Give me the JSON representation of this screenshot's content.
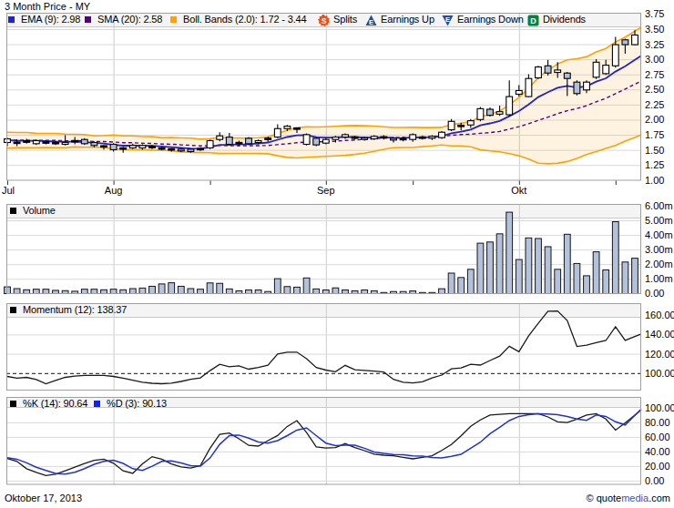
{
  "title": "3 Month Price - MY",
  "price_legend": {
    "ema_label": "EMA (9): 2.98",
    "sma_label": "SMA (20): 2.58",
    "boll_label": "Boll. Bands (2.0): 1.72 - 3.44",
    "splits_label": "Splits",
    "earnings_up_label": "Earnings Up",
    "earnings_down_label": "Earnings Down",
    "dividends_label": "Dividends",
    "splits_icon_letter": "S",
    "earnings_icon_letter": "E",
    "dividends_icon_letter": "D"
  },
  "volume_legend": {
    "label": "Volume"
  },
  "momentum_legend": {
    "label": "Momentum (12): 138.37"
  },
  "stoch_legend": {
    "k_label": "%K (14): 90.64",
    "d_label": "%D (3): 90.13"
  },
  "footer": {
    "date": "Oktober 17, 2013",
    "copyright": "© ",
    "brand_quote": "quote",
    "brand_media": "media",
    "brand_com": ".com"
  },
  "colors": {
    "ema": "#2222cc",
    "sma": "#55007f",
    "boll": "#ffa200",
    "boll_fill": "rgba(247,166,37,0.14)",
    "candle_up": "#ffffff",
    "candle_down": "#b0bfd8",
    "candle_line": "#000000",
    "volume_fill": "#b3c2d9",
    "volume_line": "#14141e",
    "momentum": "#1a1a1a",
    "stoch_k": "#1a1a1a",
    "stoch_d": "#2233cc",
    "splits_icon": "#e8521a",
    "earnings_icon": "#1b4fa0",
    "dividends_icon": "#00843d",
    "grid": "#d9d9d9",
    "month_grid": "#cccccc",
    "panel_border": "#a0a0a0",
    "strip_bg": "#f4f4f4"
  },
  "axes": {
    "price_labels": [
      "3.75",
      "3.50",
      "3.25",
      "3.00",
      "2.75",
      "2.50",
      "2.25",
      "2.00",
      "1.75",
      "1.50",
      "1.25",
      "1.00"
    ],
    "volume_labels": [
      "6.00m",
      "5.00m",
      "4.00m",
      "3.00m",
      "2.00m",
      "1.00m",
      "0.00"
    ],
    "momentum_labels": [
      "160.00",
      "140.00",
      "120.00",
      "100.00"
    ],
    "stoch_labels": [
      "100.00",
      "80.00",
      "60.00",
      "40.00",
      "20.00",
      "0.00"
    ],
    "x_labels": [
      "Jul",
      "Aug",
      "Sep",
      "Okt"
    ]
  },
  "chart_data": {
    "type": "candlestick",
    "symbol": "MY",
    "period": "3 Month Price",
    "as_of_date": "Oktober 17, 2013",
    "n_days": 66,
    "month_tick_indices": {
      "Jul": 0,
      "Aug": 11,
      "Sep": 33,
      "Okt": 53
    },
    "minor_tick_indices": [
      21,
      42,
      63
    ],
    "price_axis": {
      "min": 1.0,
      "max": 3.75,
      "step": 0.25
    },
    "volume_axis": {
      "min": 0,
      "max": 6,
      "step": 1,
      "unit": "millions"
    },
    "momentum_axis": {
      "gridlines": [
        160,
        140,
        120
      ],
      "baseline": 100
    },
    "stoch_axis": {
      "min": 0,
      "max": 100,
      "step": 20
    },
    "open": [
      1.63,
      1.63,
      1.64,
      1.61,
      1.63,
      1.62,
      1.6,
      1.66,
      1.68,
      1.63,
      1.57,
      1.6,
      1.54,
      1.54,
      1.54,
      1.55,
      1.53,
      1.52,
      1.52,
      1.52,
      1.52,
      1.54,
      1.68,
      1.72,
      1.62,
      1.7,
      1.63,
      1.68,
      1.72,
      1.86,
      1.86,
      1.6,
      1.7,
      1.62,
      1.68,
      1.72,
      1.71,
      1.71,
      1.69,
      1.71,
      1.7,
      1.68,
      1.68,
      1.71,
      1.7,
      1.71,
      1.84,
      1.9,
      1.92,
      2.01,
      2.18,
      2.1,
      2.09,
      2.43,
      2.39,
      2.7,
      2.9,
      2.79,
      2.78,
      2.63,
      2.5,
      2.71,
      2.77,
      2.9,
      3.33,
      3.25
    ],
    "high": [
      1.71,
      1.68,
      1.69,
      1.68,
      1.66,
      1.65,
      1.75,
      1.72,
      1.7,
      1.65,
      1.59,
      1.62,
      1.56,
      1.61,
      1.6,
      1.59,
      1.56,
      1.54,
      1.54,
      1.53,
      1.55,
      1.68,
      1.8,
      1.79,
      1.66,
      1.72,
      1.68,
      1.73,
      1.93,
      1.92,
      1.88,
      1.78,
      1.72,
      1.71,
      1.74,
      1.78,
      1.74,
      1.73,
      1.75,
      1.75,
      1.72,
      1.73,
      1.78,
      1.74,
      1.75,
      1.82,
      2.02,
      1.96,
      2.02,
      2.22,
      2.21,
      2.24,
      2.66,
      2.58,
      2.76,
      2.9,
      3.0,
      2.96,
      2.8,
      2.66,
      2.66,
      3.01,
      3.0,
      3.38,
      3.35,
      3.49
    ],
    "low": [
      1.57,
      1.57,
      1.61,
      1.59,
      1.6,
      1.59,
      1.58,
      1.6,
      1.59,
      1.55,
      1.51,
      1.48,
      1.46,
      1.52,
      1.51,
      1.52,
      1.5,
      1.48,
      1.47,
      1.46,
      1.49,
      1.52,
      1.65,
      1.58,
      1.57,
      1.59,
      1.6,
      1.64,
      1.7,
      1.82,
      1.79,
      1.58,
      1.57,
      1.6,
      1.63,
      1.69,
      1.68,
      1.66,
      1.67,
      1.68,
      1.63,
      1.65,
      1.64,
      1.68,
      1.67,
      1.69,
      1.82,
      1.83,
      1.87,
      1.98,
      2.06,
      2.07,
      2.06,
      2.39,
      2.38,
      2.68,
      2.74,
      2.7,
      2.4,
      2.41,
      2.45,
      2.68,
      2.75,
      2.87,
      3.1,
      3.24
    ],
    "close": [
      1.69,
      1.62,
      1.65,
      1.66,
      1.63,
      1.62,
      1.63,
      1.64,
      1.61,
      1.58,
      1.56,
      1.51,
      1.52,
      1.58,
      1.58,
      1.56,
      1.53,
      1.51,
      1.49,
      1.48,
      1.52,
      1.66,
      1.74,
      1.6,
      1.62,
      1.61,
      1.66,
      1.7,
      1.86,
      1.9,
      1.86,
      1.76,
      1.59,
      1.68,
      1.72,
      1.76,
      1.71,
      1.68,
      1.73,
      1.72,
      1.67,
      1.69,
      1.76,
      1.71,
      1.73,
      1.8,
      1.98,
      1.91,
      1.99,
      2.19,
      2.08,
      2.14,
      2.39,
      2.49,
      2.69,
      2.88,
      2.78,
      2.83,
      2.69,
      2.44,
      2.63,
      2.96,
      2.91,
      3.25,
      3.25,
      3.41
    ],
    "volume_m": [
      0.48,
      0.36,
      0.28,
      0.32,
      0.32,
      0.24,
      0.22,
      0.18,
      0.32,
      0.32,
      0.28,
      0.32,
      0.28,
      0.36,
      0.4,
      0.52,
      0.68,
      0.76,
      0.52,
      0.36,
      0.32,
      0.75,
      0.72,
      0.34,
      0.21,
      0.27,
      0.27,
      0.16,
      1.04,
      0.5,
      0.46,
      1.09,
      0.34,
      0.27,
      0.41,
      0.27,
      0.21,
      0.27,
      0.21,
      0.08,
      0.16,
      0.16,
      0.2,
      0.06,
      0.07,
      0.35,
      1.42,
      1.12,
      1.68,
      3.47,
      3.55,
      4.11,
      5.59,
      2.35,
      3.83,
      3.79,
      3.23,
      1.68,
      4.08,
      2.08,
      1.24,
      2.88,
      1.64,
      4.94,
      2.18,
      2.44
    ],
    "ema9": [
      1.67,
      1.66,
      1.658,
      1.658,
      1.653,
      1.646,
      1.643,
      1.642,
      1.636,
      1.625,
      1.612,
      1.591,
      1.577,
      1.578,
      1.578,
      1.575,
      1.566,
      1.554,
      1.542,
      1.529,
      1.527,
      1.554,
      1.591,
      1.593,
      1.598,
      1.601,
      1.613,
      1.63,
      1.676,
      1.721,
      1.749,
      1.751,
      1.719,
      1.711,
      1.713,
      1.722,
      1.72,
      1.712,
      1.715,
      1.716,
      1.707,
      1.704,
      1.715,
      1.714,
      1.717,
      1.734,
      1.783,
      1.808,
      1.845,
      1.914,
      1.947,
      1.986,
      2.066,
      2.151,
      2.259,
      2.383,
      2.463,
      2.536,
      2.567,
      2.541,
      2.559,
      2.639,
      2.693,
      2.805,
      2.894,
      2.997
    ],
    "sma20": [
      1.667,
      1.669,
      1.668,
      1.663,
      1.664,
      1.663,
      1.657,
      1.661,
      1.657,
      1.647,
      1.645,
      1.638,
      1.627,
      1.625,
      1.618,
      1.615,
      1.605,
      1.601,
      1.591,
      1.583,
      1.574,
      1.576,
      1.581,
      1.578,
      1.577,
      1.577,
      1.578,
      1.581,
      1.594,
      1.609,
      1.625,
      1.637,
      1.641,
      1.646,
      1.652,
      1.663,
      1.671,
      1.68,
      1.692,
      1.704,
      1.711,
      1.713,
      1.714,
      1.72,
      1.725,
      1.734,
      1.75,
      1.761,
      1.768,
      1.782,
      1.793,
      1.812,
      1.852,
      1.893,
      1.941,
      1.997,
      2.05,
      2.108,
      2.156,
      2.192,
      2.24,
      2.304,
      2.361,
      2.438,
      2.514,
      2.595
    ],
    "bb_upper": [
      1.799,
      1.796,
      1.796,
      1.782,
      1.781,
      1.781,
      1.771,
      1.766,
      1.762,
      1.741,
      1.744,
      1.752,
      1.74,
      1.74,
      1.728,
      1.727,
      1.707,
      1.711,
      1.705,
      1.701,
      1.685,
      1.692,
      1.713,
      1.705,
      1.704,
      1.703,
      1.708,
      1.719,
      1.777,
      1.836,
      1.875,
      1.888,
      1.887,
      1.891,
      1.898,
      1.908,
      1.91,
      1.907,
      1.902,
      1.891,
      1.879,
      1.879,
      1.881,
      1.878,
      1.877,
      1.88,
      1.927,
      1.949,
      1.977,
      2.056,
      2.095,
      2.149,
      2.257,
      2.375,
      2.528,
      2.706,
      2.823,
      2.931,
      2.997,
      3.017,
      3.049,
      3.129,
      3.188,
      3.294,
      3.375,
      3.474
    ],
    "bb_lower": [
      1.535,
      1.542,
      1.541,
      1.544,
      1.548,
      1.545,
      1.544,
      1.557,
      1.552,
      1.553,
      1.547,
      1.524,
      1.513,
      1.51,
      1.509,
      1.503,
      1.502,
      1.491,
      1.478,
      1.464,
      1.463,
      1.46,
      1.448,
      1.45,
      1.45,
      1.45,
      1.448,
      1.443,
      1.41,
      1.383,
      1.374,
      1.386,
      1.394,
      1.4,
      1.407,
      1.417,
      1.433,
      1.453,
      1.482,
      1.517,
      1.544,
      1.547,
      1.547,
      1.561,
      1.573,
      1.589,
      1.574,
      1.573,
      1.558,
      1.508,
      1.491,
      1.475,
      1.447,
      1.41,
      1.354,
      1.288,
      1.278,
      1.285,
      1.315,
      1.367,
      1.431,
      1.478,
      1.534,
      1.582,
      1.653,
      1.715
    ],
    "momentum12": [
      97.0,
      95.3,
      96.0,
      93.8,
      89.4,
      92.8,
      96.0,
      97.4,
      98.0,
      98.0,
      98.0,
      97.0,
      95.2,
      93.0,
      91.0,
      89.9,
      89.4,
      90.0,
      91.8,
      94.0,
      95.5,
      103.0,
      109.5,
      107.1,
      108.0,
      104.5,
      106.3,
      108.7,
      120.2,
      122.2,
      122.2,
      115.5,
      106.2,
      103.6,
      101.8,
      108.5,
      104.0,
      103.3,
      102.5,
      101.5,
      94.0,
      91.0,
      90.3,
      91.5,
      95.5,
      98.4,
      104.8,
      105.8,
      109.5,
      108.8,
      113.5,
      118.0,
      128.2,
      122.5,
      139.0,
      152.0,
      164.5,
      164.8,
      155.0,
      128.0,
      129.3,
      132.0,
      134.2,
      148.5,
      134.3,
      138.37
    ],
    "stoch_k": [
      31,
      27,
      17,
      12,
      7.5,
      9.5,
      14,
      19,
      24,
      28.5,
      30,
      24.5,
      14,
      10.5,
      23.5,
      33.5,
      30,
      23.5,
      19.5,
      17.8,
      21.2,
      45,
      64,
      66,
      58,
      49,
      48,
      55.5,
      62.5,
      75,
      83,
      66.5,
      47,
      45.2,
      45.9,
      51.4,
      45.9,
      41.8,
      37,
      35.5,
      34.7,
      32.5,
      30.5,
      32.5,
      34.7,
      42,
      50.3,
      62,
      75.1,
      84,
      90.7,
      91.5,
      92.5,
      92.5,
      92.5,
      92.5,
      88,
      81.4,
      80.2,
      85,
      90.7,
      92.5,
      85.3,
      70,
      80,
      90.64
    ],
    "stoch_d": [
      32,
      30,
      25,
      19,
      14.5,
      10.5,
      9.6,
      12,
      17,
      23,
      27,
      28.5,
      24.3,
      17,
      14.5,
      20.4,
      27,
      27.8,
      24.7,
      21.2,
      20.6,
      31.6,
      50.4,
      62.4,
      63.1,
      59,
      53.8,
      52.1,
      55.5,
      62.4,
      70,
      73,
      62.4,
      52.1,
      48.6,
      49.3,
      49.3,
      45,
      40,
      38,
      36.5,
      36,
      34.5,
      34.1,
      32.5,
      31.7,
      34,
      36.6,
      45,
      53.4,
      65,
      73.9,
      83,
      88.8,
      91,
      92.5,
      92,
      91.3,
      88.8,
      85.3,
      83.4,
      90.7,
      88.8,
      81.4,
      77,
      90.13
    ]
  }
}
